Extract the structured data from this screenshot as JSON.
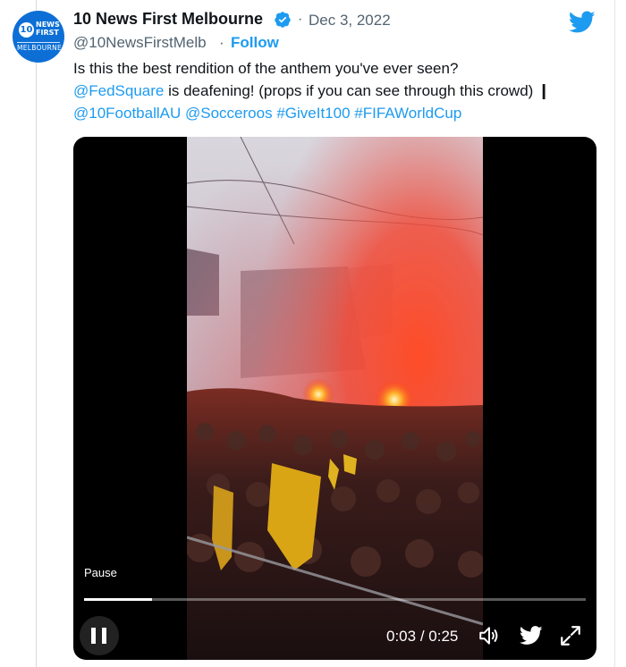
{
  "account": {
    "display_name": "10 News First Melbourne",
    "handle": "@10NewsFirstMelb",
    "follow_label": "Follow",
    "date": "Dec 3, 2022",
    "separator": "·"
  },
  "avatar": {
    "badge": "10",
    "line1": "NEWS",
    "line2": "FIRST",
    "line3": "MELBOURNE"
  },
  "tweet": {
    "line1": "Is this the best rendition of the anthem you've ever seen?",
    "mention_fedsquare": "@FedSquare",
    "line2_rest": " is deafening! (props if you can see through this crowd) ❙",
    "mention_football": "@10FootballAU",
    "mention_socceroos": "@Socceroos",
    "hashtag_giveit": "#GiveIt100",
    "hashtag_fifa": "#FIFAWorldCup"
  },
  "video": {
    "tooltip": "Pause",
    "current_time": "0:03",
    "duration": "0:25",
    "time_separator": " / ",
    "progress_fraction": 0.135
  },
  "icons": {
    "verified": "verified-badge-icon",
    "bird": "twitter-bird-icon",
    "pause": "pause-icon",
    "volume": "volume-icon",
    "share_bird": "twitter-logo-icon",
    "expand": "expand-icon"
  },
  "colors": {
    "link": "#1d9bf0",
    "text": "#0f1419",
    "muted": "#536471",
    "avatar_bg": "#0d6fd6",
    "flare": "#ff3b1f"
  }
}
